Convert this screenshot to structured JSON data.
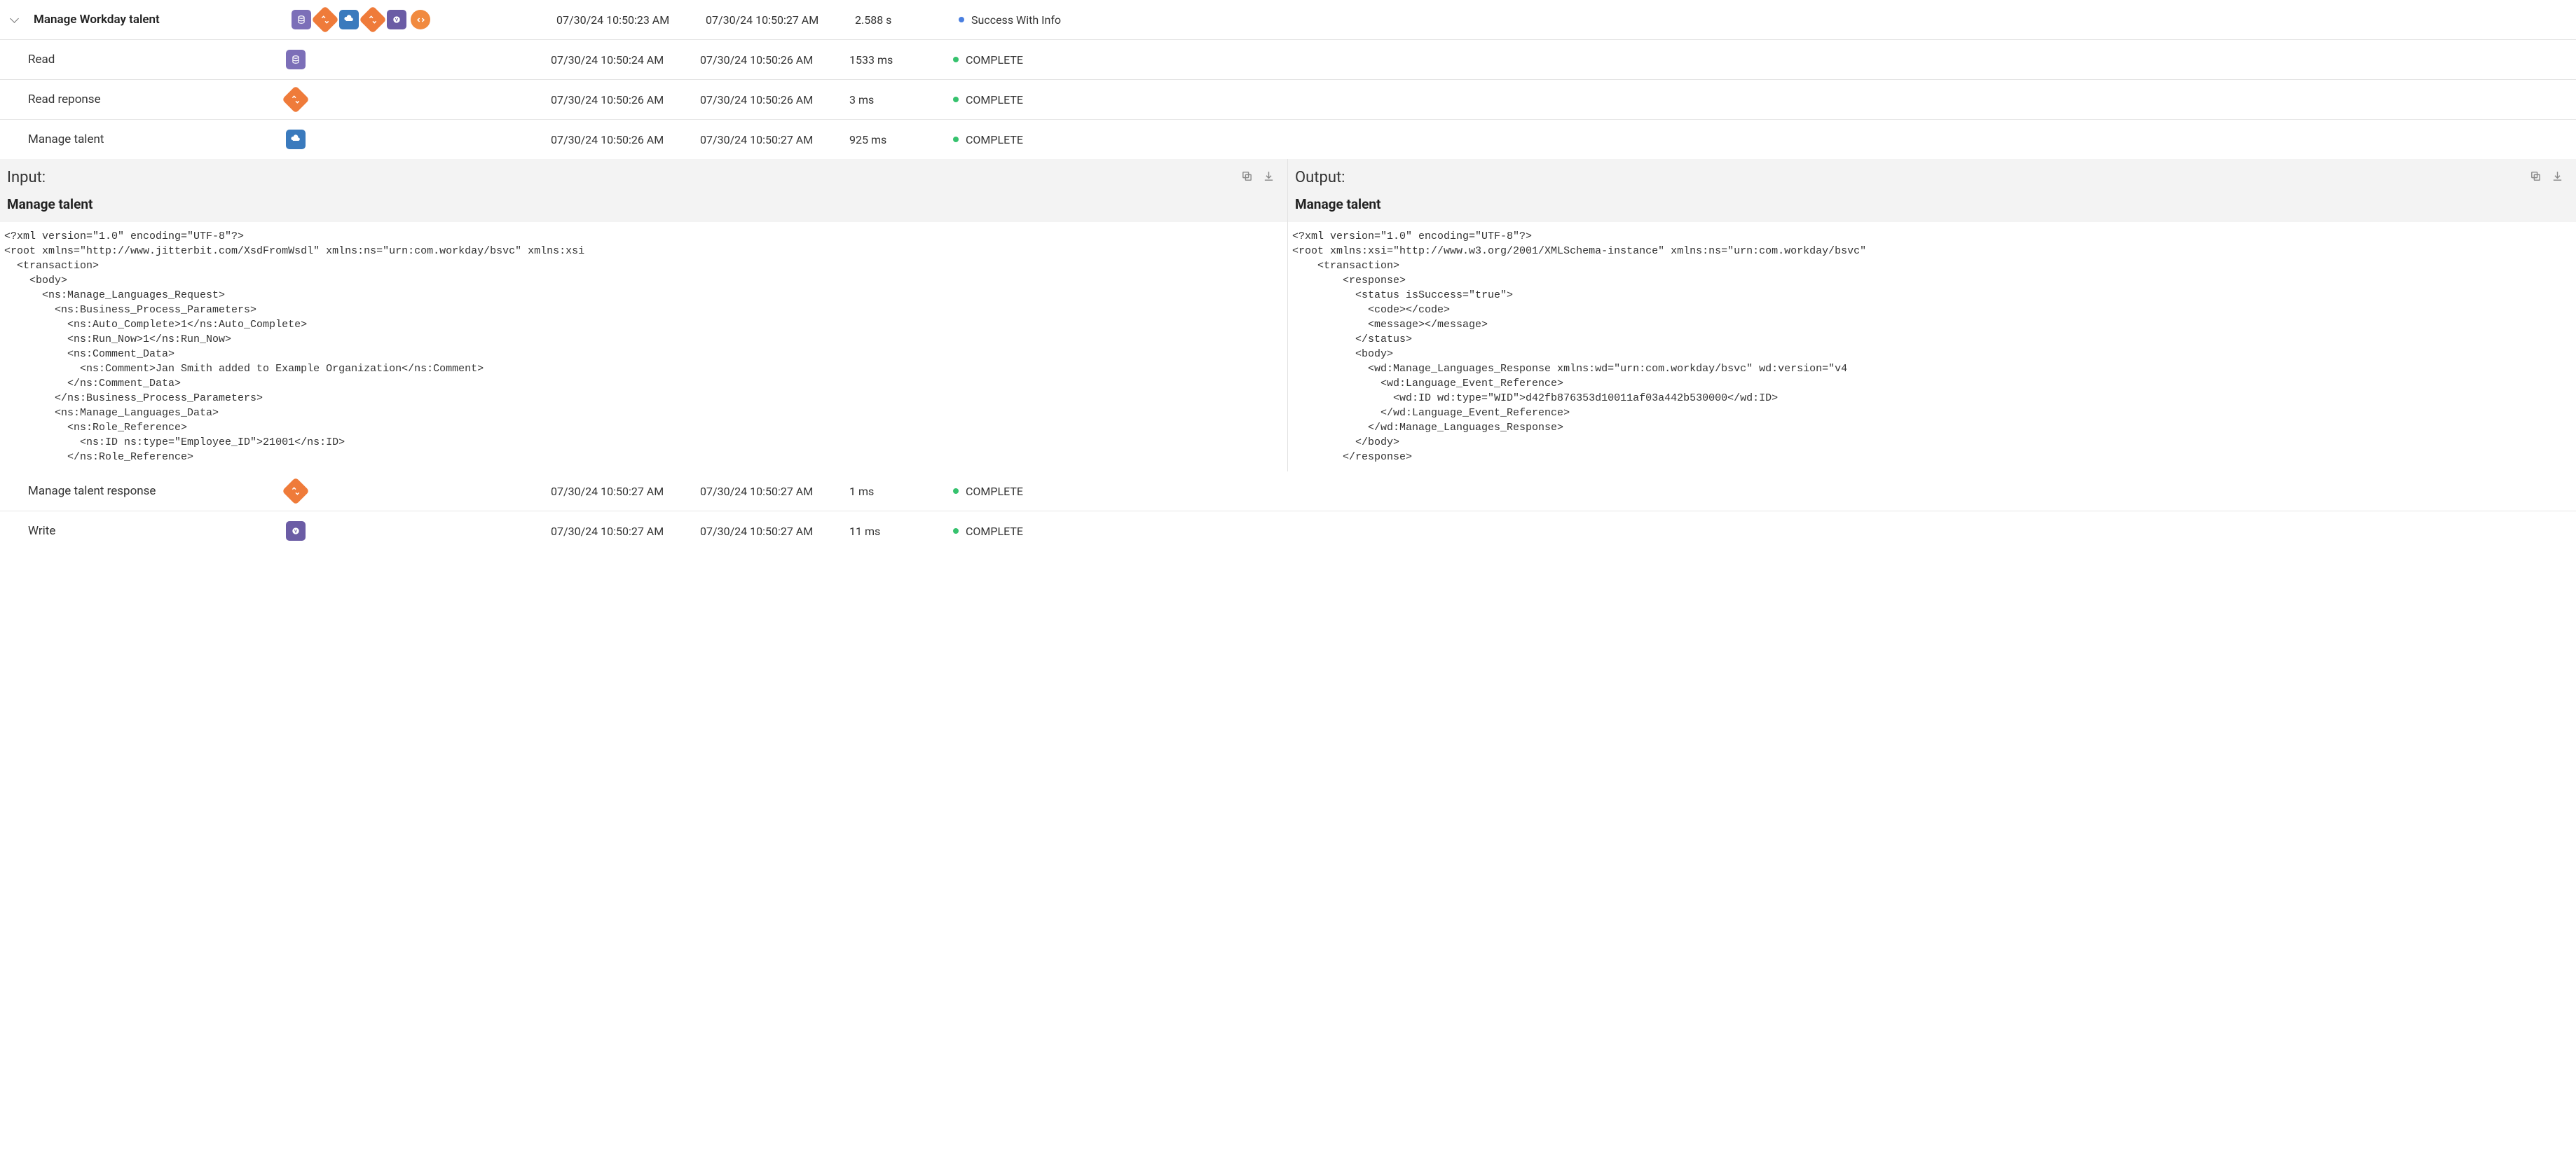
{
  "rows": [
    {
      "id": "r0",
      "expandable": true,
      "indent": false,
      "name": "Manage Workday talent",
      "icons": [
        "purple-db",
        "orange-diamond",
        "blue-cloud",
        "orange-diamond",
        "violet-v",
        "orange-code"
      ],
      "start": "07/30/24 10:50:23 AM",
      "end": "07/30/24 10:50:27 AM",
      "duration": "2.588 s",
      "status": "Success With Info",
      "dot": "blue"
    },
    {
      "id": "r1",
      "indent": true,
      "name": "Read",
      "icons": [
        "purple-db"
      ],
      "start": "07/30/24 10:50:24 AM",
      "end": "07/30/24 10:50:26 AM",
      "duration": "1533 ms",
      "status": "COMPLETE",
      "dot": "green"
    },
    {
      "id": "r2",
      "indent": true,
      "name": "Read reponse",
      "icons": [
        "orange-diamond"
      ],
      "start": "07/30/24 10:50:26 AM",
      "end": "07/30/24 10:50:26 AM",
      "duration": "3 ms",
      "status": "COMPLETE",
      "dot": "green"
    },
    {
      "id": "r3",
      "indent": true,
      "name": "Manage talent",
      "icons": [
        "blue-cloud"
      ],
      "start": "07/30/24 10:50:26 AM",
      "end": "07/30/24 10:50:27 AM",
      "duration": "925 ms",
      "status": "COMPLETE",
      "dot": "green",
      "noBorder": true
    }
  ],
  "rows_after": [
    {
      "id": "r4",
      "indent": true,
      "name": "Manage talent response",
      "icons": [
        "orange-diamond"
      ],
      "start": "07/30/24 10:50:27 AM",
      "end": "07/30/24 10:50:27 AM",
      "duration": "1 ms",
      "status": "COMPLETE",
      "dot": "green"
    },
    {
      "id": "r5",
      "indent": true,
      "name": "Write",
      "icons": [
        "violet-v"
      ],
      "start": "07/30/24 10:50:27 AM",
      "end": "07/30/24 10:50:27 AM",
      "duration": "11 ms",
      "status": "COMPLETE",
      "dot": "green",
      "noBorder": true
    }
  ],
  "panels": {
    "input": {
      "title": "Input:",
      "subtitle": "Manage talent",
      "code": "<?xml version=\"1.0\" encoding=\"UTF-8\"?>\n<root xmlns=\"http://www.jitterbit.com/XsdFromWsdl\" xmlns:ns=\"urn:com.workday/bsvc\" xmlns:xsi\n  <transaction>\n    <body>\n      <ns:Manage_Languages_Request>\n        <ns:Business_Process_Parameters>\n          <ns:Auto_Complete>1</ns:Auto_Complete>\n          <ns:Run_Now>1</ns:Run_Now>\n          <ns:Comment_Data>\n            <ns:Comment>Jan Smith added to Example Organization</ns:Comment>\n          </ns:Comment_Data>\n        </ns:Business_Process_Parameters>\n        <ns:Manage_Languages_Data>\n          <ns:Role_Reference>\n            <ns:ID ns:type=\"Employee_ID\">21001</ns:ID>\n          </ns:Role_Reference>"
    },
    "output": {
      "title": "Output:",
      "subtitle": "Manage talent",
      "code": "<?xml version=\"1.0\" encoding=\"UTF-8\"?>\n<root xmlns:xsi=\"http://www.w3.org/2001/XMLSchema-instance\" xmlns:ns=\"urn:com.workday/bsvc\"\n    <transaction>\n        <response>\n          <status isSuccess=\"true\">\n            <code></code>\n            <message></message>\n          </status>\n          <body>\n            <wd:Manage_Languages_Response xmlns:wd=\"urn:com.workday/bsvc\" wd:version=\"v4\n              <wd:Language_Event_Reference>\n                <wd:ID wd:type=\"WID\">d42fb876353d10011af03a442b530000</wd:ID>\n              </wd:Language_Event_Reference>\n            </wd:Manage_Languages_Response>\n          </body>\n        </response>"
    }
  }
}
